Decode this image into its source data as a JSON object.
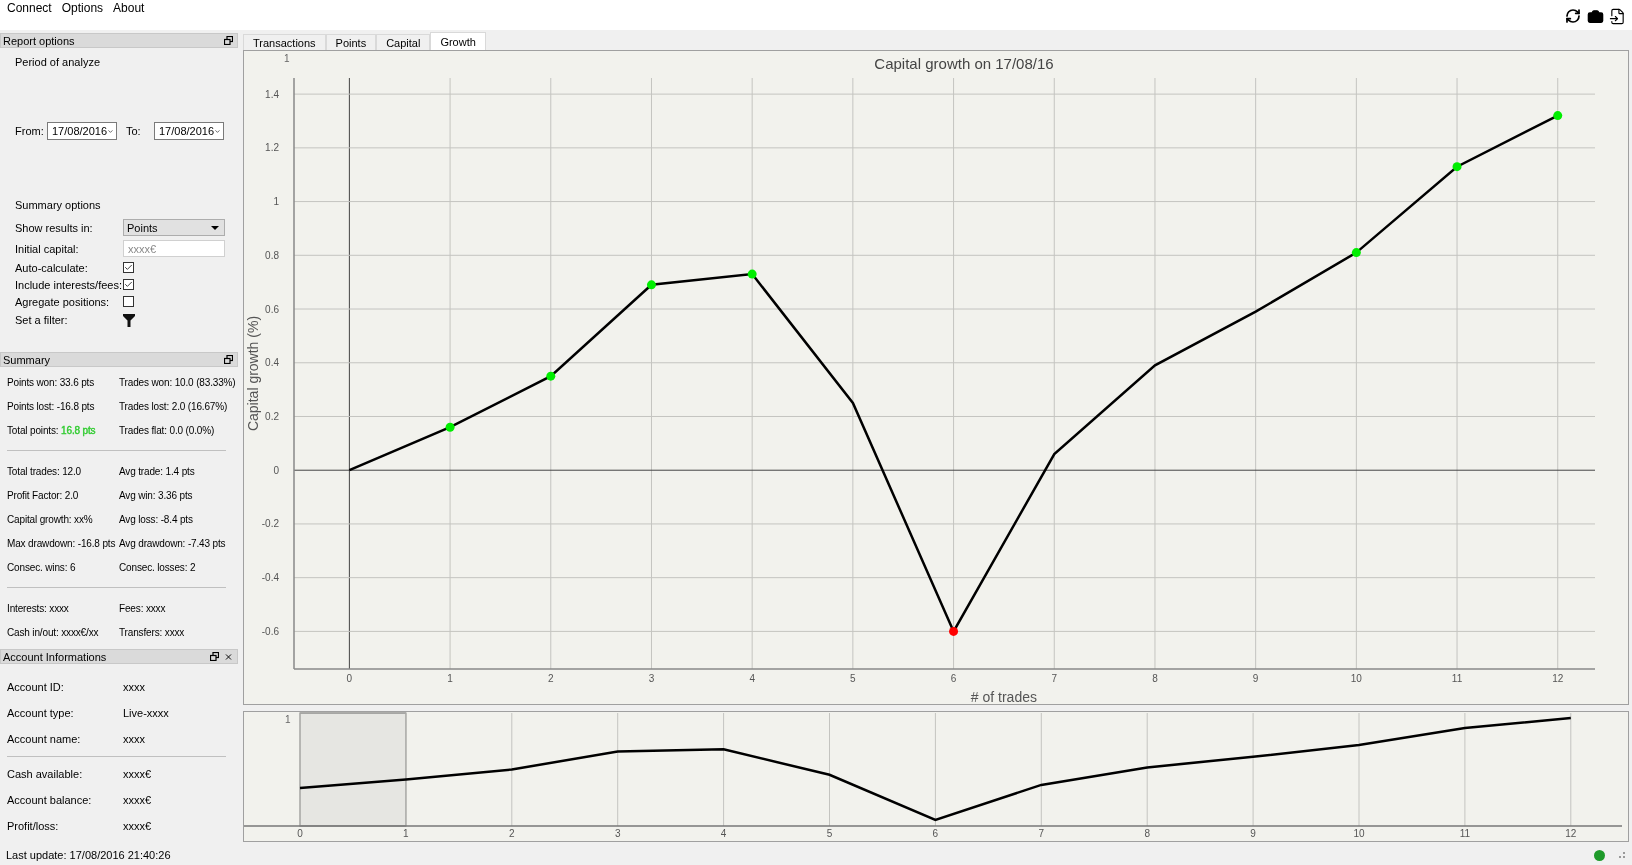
{
  "menu": [
    "Connect",
    "Options",
    "About"
  ],
  "report_options": {
    "title": "Report options",
    "period_label": "Period of analyze",
    "from_label": "From:",
    "from_value": "17/08/2016",
    "to_label": "To:",
    "to_value": "17/08/2016",
    "summary_options_label": "Summary options",
    "options": [
      {
        "kind": "select",
        "label": "Show results in:",
        "value": "Points"
      },
      {
        "kind": "input",
        "label": "Initial capital:",
        "placeholder": "xxxx€"
      },
      {
        "kind": "checkbox",
        "label": "Auto-calculate:",
        "checked": true
      },
      {
        "kind": "checkbox",
        "label": "Include interests/fees:",
        "checked": true
      },
      {
        "kind": "checkbox",
        "label": "Agregate positions:",
        "checked": false
      },
      {
        "kind": "filter",
        "label": "Set a filter:"
      }
    ]
  },
  "summary": {
    "title": "Summary",
    "groups": [
      [
        [
          {
            "label": "Points won:",
            "value": "33.6 pts"
          },
          {
            "label": "Trades won:",
            "value": "10.0 (83.33%)"
          }
        ],
        [
          {
            "label": "Points lost:",
            "value": "-16.8 pts"
          },
          {
            "label": "Trades lost:",
            "value": "2.0 (16.67%)"
          }
        ],
        [
          {
            "label": "Total points:",
            "value": "16.8 pts",
            "color": "#33cc33"
          },
          {
            "label": "Trades flat:",
            "value": "0.0 (0.0%)"
          }
        ]
      ],
      [
        [
          {
            "label": "Total trades:",
            "value": "12.0"
          },
          {
            "label": "Avg trade:",
            "value": "1.4 pts"
          }
        ],
        [
          {
            "label": "Profit Factor:",
            "value": "2.0"
          },
          {
            "label": "Avg win:",
            "value": "3.36 pts"
          }
        ],
        [
          {
            "label": "Capital growth:",
            "value": "xx%"
          },
          {
            "label": "Avg loss:",
            "value": "-8.4 pts"
          }
        ],
        [
          {
            "label": "Max drawdown:",
            "value": "-16.8 pts"
          },
          {
            "label": "Avg drawdown:",
            "value": "-7.43 pts"
          }
        ],
        [
          {
            "label": "Consec. wins:",
            "value": "6"
          },
          {
            "label": "Consec. losses:",
            "value": "2"
          }
        ]
      ],
      [
        [
          {
            "label": "Interests:",
            "value": "xxxx"
          },
          {
            "label": "Fees:",
            "value": "xxxx"
          }
        ],
        [
          {
            "label": "Cash in/out:",
            "value": "xxxx€/xx"
          },
          {
            "label": "Transfers:",
            "value": "xxxx"
          }
        ]
      ]
    ]
  },
  "account": {
    "title": "Account Informations",
    "groups": [
      [
        {
          "label": "Account ID:",
          "value": "xxxx"
        },
        {
          "label": "Account type:",
          "value": "Live-xxxx"
        },
        {
          "label": "Account name:",
          "value": "xxxx"
        }
      ],
      [
        {
          "label": "Cash available:",
          "value": "xxxx€"
        },
        {
          "label": "Account balance:",
          "value": "xxxx€"
        },
        {
          "label": "Profit/loss:",
          "value": "xxxx€"
        }
      ]
    ]
  },
  "tabs": [
    {
      "label": "Transactions",
      "selected": false
    },
    {
      "label": "Points",
      "selected": false
    },
    {
      "label": "Capital",
      "selected": false
    },
    {
      "label": "Growth",
      "selected": true
    }
  ],
  "chart": {
    "corner_label": "1",
    "chart_data": {
      "type": "line",
      "title": "Capital growth on 17/08/16",
      "xlabel": "# of trades",
      "ylabel": "Capital growth (%)",
      "x": [
        0,
        1,
        2,
        3,
        4,
        5,
        6,
        7,
        8,
        9,
        10,
        11,
        12
      ],
      "grid": true,
      "series": [
        {
          "color": "#000000",
          "values": [
            0,
            0.16,
            0.35,
            0.69,
            0.73,
            0.25,
            -0.6,
            0.06,
            0.39,
            0.59,
            0.81,
            1.13,
            1.32
          ]
        }
      ],
      "xlim": [
        -0.55,
        12.37
      ],
      "ylim": [
        -0.74,
        1.46
      ],
      "xticks": [
        0,
        1,
        2,
        3,
        4,
        5,
        6,
        7,
        8,
        9,
        10,
        11,
        12
      ],
      "yticks": [
        -0.6,
        -0.4,
        -0.2,
        0,
        0.2,
        0.4,
        0.6,
        0.8,
        1,
        1.2,
        1.4
      ]
    },
    "point_marks": [
      {
        "kind": "none"
      },
      {
        "kind": "dot",
        "color": "#00ee00"
      },
      {
        "kind": "dot",
        "color": "#00ee00"
      },
      {
        "kind": "dot",
        "color": "#00ee00"
      },
      {
        "kind": "dot",
        "color": "#00ee00"
      },
      {
        "kind": "none"
      },
      {
        "kind": "dot",
        "color": "#ff0000"
      },
      {
        "kind": "none"
      },
      {
        "kind": "none"
      },
      {
        "kind": "none"
      },
      {
        "kind": "dot",
        "color": "#00ee00"
      },
      {
        "kind": "dot",
        "color": "#00ee00"
      },
      {
        "kind": "dot",
        "color": "#00ee00"
      }
    ]
  },
  "overview": {
    "corner_label": "1",
    "ticks": [
      {
        "label": "0",
        "selected": true
      },
      {
        "label": "1",
        "selected": true
      },
      {
        "label": "2",
        "selected": false
      },
      {
        "label": "3",
        "selected": false
      },
      {
        "label": "4",
        "selected": false
      },
      {
        "label": "5",
        "selected": false
      },
      {
        "label": "6",
        "selected": false
      },
      {
        "label": "7",
        "selected": false
      },
      {
        "label": "8",
        "selected": false
      },
      {
        "label": "9",
        "selected": false
      },
      {
        "label": "10",
        "selected": false
      },
      {
        "label": "11",
        "selected": false
      },
      {
        "label": "12",
        "selected": false
      }
    ]
  },
  "status_bar": {
    "text": "Last update: 17/08/2016 21:40:26",
    "connected": true
  }
}
